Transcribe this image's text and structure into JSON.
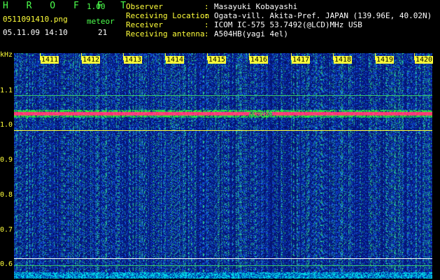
{
  "header": {
    "app_name": "H R O F F T",
    "version": "1.00",
    "filename": "0511091410.png",
    "meteor_label": "meteor",
    "datetime": "05.11.09 14:10",
    "meteor_count": "21"
  },
  "meta": [
    {
      "label": "Observer",
      "value": "Masayuki Kobayashi"
    },
    {
      "label": "Receiving Location",
      "value": "Ogata-vill. Akita-Pref. JAPAN (139.96E, 40.02N)"
    },
    {
      "label": "Receiver",
      "value": "ICOM IC-575 53.7492(@LCD)MHz USB"
    },
    {
      "label": "Receiving antenna",
      "value": "A504HB(yagi 4el)"
    }
  ],
  "meta_colon": ":",
  "y_axis": {
    "unit": "kHz",
    "ticks": [
      "1.1",
      "1.0",
      "0.9",
      "0.8",
      "0.7",
      "0.6"
    ],
    "range": [
      0.585,
      1.16
    ]
  },
  "time_axis": {
    "minutes": [
      "1411",
      "1412",
      "1413",
      "1414",
      "1415",
      "1416",
      "1417",
      "1418",
      "1419",
      "1420"
    ]
  },
  "colors": {
    "background": "#000000",
    "header_text": "#4cff4c",
    "label_text": "#ffff3a",
    "value_text": "#ffffff",
    "carrier": "#ff2a6a",
    "noise_base": "#0b1f8c",
    "noise_floor_line": "#00e5ff"
  }
}
